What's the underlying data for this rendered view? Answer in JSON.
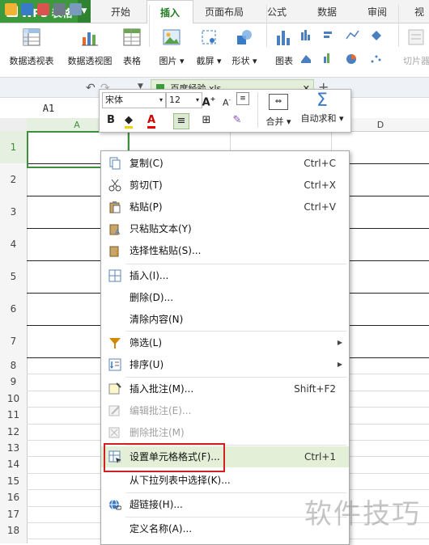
{
  "app": {
    "name": "WPS 表格",
    "logo": "S",
    "accent": "#3c9a3c"
  },
  "tabs": [
    "开始",
    "插入",
    "页面布局",
    "公式",
    "数据",
    "审阅",
    "视"
  ],
  "active_tab": "插入",
  "ribbon": {
    "pivot_table": "数据透视表",
    "pivot_chart": "数据透视图",
    "table": "表格",
    "picture": "图片",
    "screenshot": "截屏",
    "shape": "形状",
    "chart": "图表",
    "slicer": "切片器"
  },
  "document": {
    "tab_label": "百度经验.xls"
  },
  "name_box": "A1",
  "columns": [
    "A",
    "D"
  ],
  "rows": [
    "1",
    "2",
    "3",
    "4",
    "5",
    "6",
    "7",
    "8",
    "9",
    "10",
    "11",
    "12",
    "13",
    "14",
    "15",
    "16",
    "17",
    "18"
  ],
  "mini_toolbar": {
    "font_name": "宋体",
    "font_size": "12",
    "bold": "B",
    "merge_label": "合并",
    "autosum_label": "自动求和"
  },
  "context_menu": {
    "copy": {
      "label": "复制(C)",
      "shortcut": "Ctrl+C"
    },
    "cut": {
      "label": "剪切(T)",
      "shortcut": "Ctrl+X"
    },
    "paste": {
      "label": "粘贴(P)",
      "shortcut": "Ctrl+V"
    },
    "paste_text": {
      "label": "只粘贴文本(Y)"
    },
    "paste_special": {
      "label": "选择性粘贴(S)..."
    },
    "insert": {
      "label": "插入(I)..."
    },
    "delete": {
      "label": "删除(D)..."
    },
    "clear": {
      "label": "清除内容(N)"
    },
    "filter": {
      "label": "筛选(L)"
    },
    "sort": {
      "label": "排序(U)"
    },
    "insert_comment": {
      "label": "插入批注(M)...",
      "shortcut": "Shift+F2"
    },
    "edit_comment": {
      "label": "编辑批注(E)..."
    },
    "delete_comment": {
      "label": "删除批注(M)"
    },
    "format_cells": {
      "label": "设置单元格格式(F)...",
      "shortcut": "Ctrl+1"
    },
    "pick_from_list": {
      "label": "从下拉列表中选择(K)..."
    },
    "hyperlink": {
      "label": "超链接(H)..."
    },
    "define_name": {
      "label": "定义名称(A)..."
    }
  },
  "watermark": "软件技巧"
}
